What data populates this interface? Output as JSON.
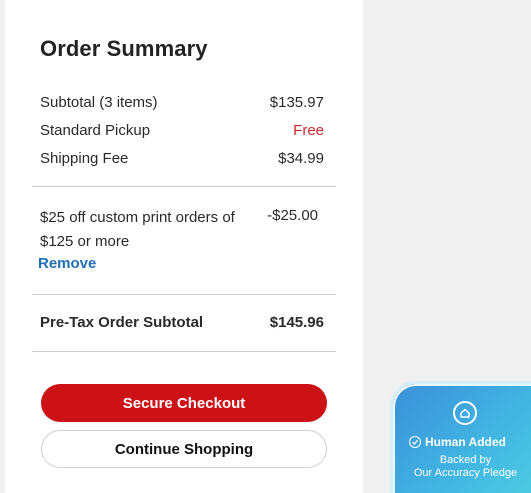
{
  "summary": {
    "title": "Order Summary",
    "lines": [
      {
        "label": "Subtotal (3 items)",
        "value": "$135.97"
      },
      {
        "label": "Standard Pickup",
        "value": "Free"
      },
      {
        "label": "Shipping Fee",
        "value": "$34.99"
      }
    ],
    "discount": {
      "label": "$25 off custom print orders of $125 or more",
      "value": "-$25.00",
      "remove_label": "Remove"
    },
    "pretax": {
      "label": "Pre-Tax Order Subtotal",
      "value": "$145.96"
    }
  },
  "buttons": {
    "checkout": "Secure Checkout",
    "continue": "Continue Shopping"
  },
  "badge": {
    "title": "Human Added",
    "line1": "Backed by",
    "line2": "Our Accuracy Pledge",
    "icon": "home-badge-icon"
  },
  "colors": {
    "checkout_bg": "#cc1117",
    "free_text": "#d0282d",
    "link": "#1f6fb5"
  }
}
